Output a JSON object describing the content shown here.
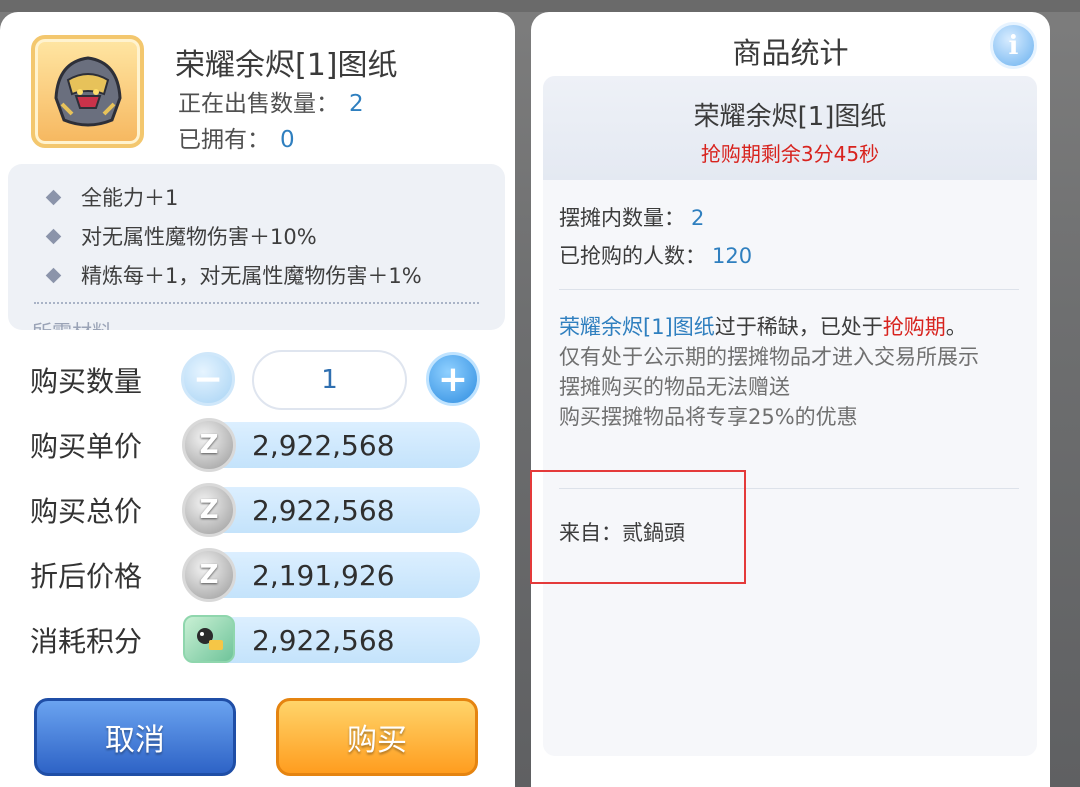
{
  "colors": {
    "accent_blue": "#2f7fbf",
    "alert_red": "#d8231e",
    "cancel_button": "#2e63c6",
    "buy_button": "#ff9d1f"
  },
  "left": {
    "item_title": "荣耀余烬[1]图纸",
    "on_sale_label": "正在出售数量：",
    "on_sale_value": "2",
    "owned_label": "已拥有：",
    "owned_value": "0",
    "effects": [
      "全能力＋1",
      "对无属性魔物伤害＋10%",
      "精炼每＋1，对无属性魔物伤害＋1%"
    ],
    "partial_text": "所需材料",
    "quantity_label": "购买数量",
    "quantity_value": "1",
    "minus_symbol": "−",
    "plus_symbol": "+",
    "unit_price_label": "购买单价",
    "unit_price_value": "2,922,568",
    "total_price_label": "购买总价",
    "total_price_value": "2,922,568",
    "discount_price_label": "折后价格",
    "discount_price_value": "2,191,926",
    "points_label": "消耗积分",
    "points_value": "2,922,568",
    "coin_symbol": "Z",
    "cancel_label": "取消",
    "buy_label": "购买",
    "icons": {
      "item": "helmet-icon",
      "coin": "zeny-coin-icon",
      "points": "points-card-icon"
    }
  },
  "right": {
    "panel_title": "商品统计",
    "info_symbol": "i",
    "item_name": "荣耀余烬[1]图纸",
    "timer_text": "抢购期剩余3分45秒",
    "stall_qty_label": "摆摊内数量：",
    "stall_qty_value": "2",
    "buyers_label": "已抢购的人数：",
    "buyers_value": "120",
    "desc_item_name": "荣耀余烬[1]图纸",
    "desc_line1_mid": "过于稀缺，已处于",
    "desc_line1_red": "抢购期",
    "desc_line1_end": "。",
    "desc_line2": "仅有处于公示期的摆摊物品才进入交易所展示",
    "desc_line3": "摆摊购买的物品无法赠送",
    "desc_line4": "购买摆摊物品将专享25%的优惠",
    "from_label": "来自：",
    "from_value": "贰鍋頭"
  }
}
